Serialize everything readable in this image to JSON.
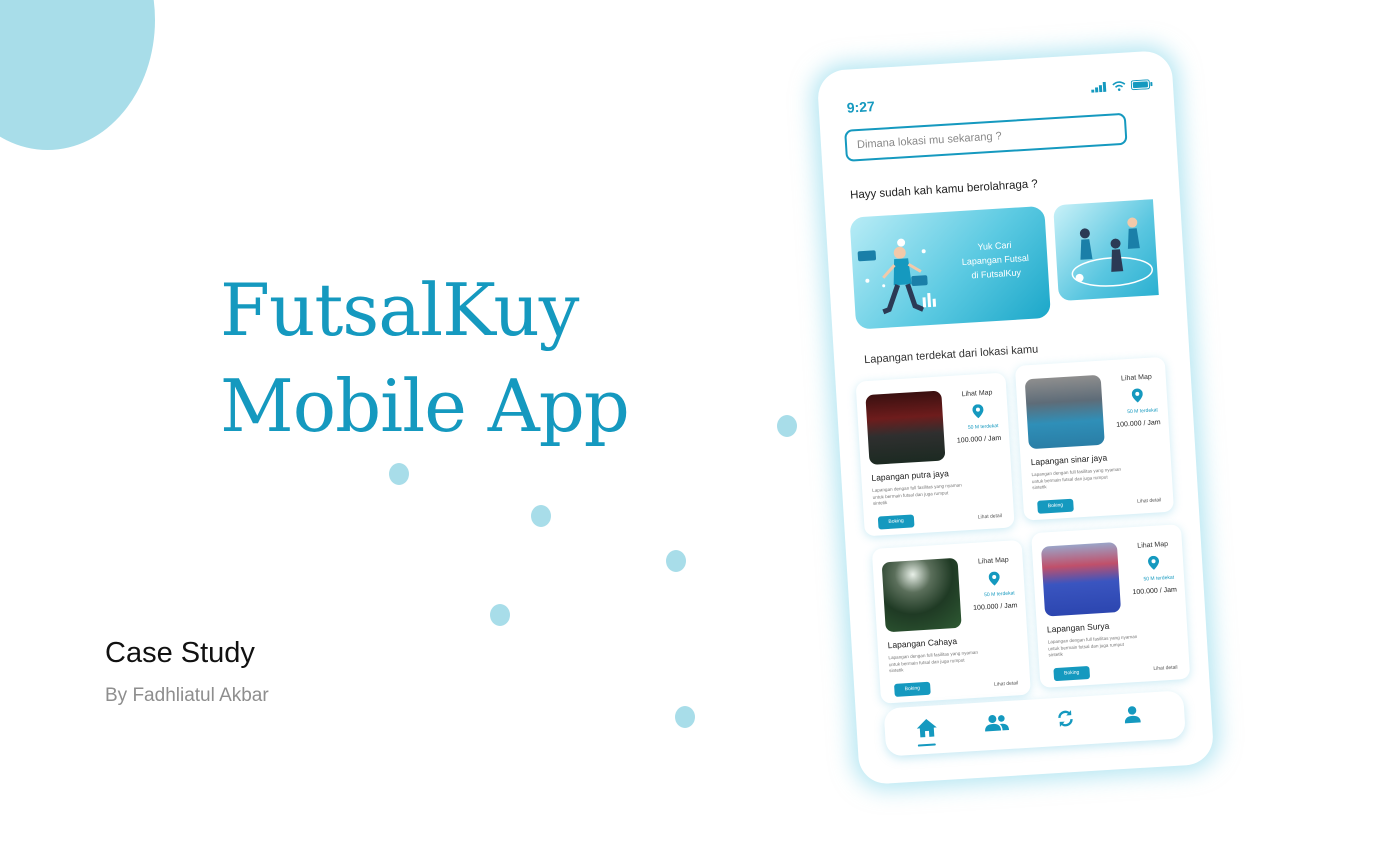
{
  "hero": {
    "title_line1": "FutsalKuy",
    "title_line2": "Mobile App",
    "subtitle": "Case Study",
    "byline": "By Fadhliatul Akbar"
  },
  "colors": {
    "brand": "#1599bf",
    "accent_soft": "#a8dde9"
  },
  "phone": {
    "status_time": "9:27",
    "search_placeholder": "Dimana lokasi mu sekarang ?",
    "greeting": "Hayy sudah kah kamu berolahraga ?",
    "banner": {
      "line1": "Yuk Cari",
      "line2": "Lapangan Futsal",
      "line3": "di FutsalKuy"
    },
    "section_title": "Lapangan terdekat dari lokasi kamu",
    "cards": [
      {
        "name": "Lapangan putra jaya",
        "map_label": "Lihat Map",
        "distance": "50 M terdekat",
        "price": "100.000 / Jam",
        "description": "Lapangan dengan full fasilitas yang nyaman untuk bermain futsal dan juga rumput sintetik",
        "book_label": "Boking",
        "detail_label": "Lihat detail"
      },
      {
        "name": "Lapangan sinar jaya",
        "map_label": "Lihat Map",
        "distance": "50 M terdekat",
        "price": "100.000 / Jam",
        "description": "Lapangan dengan full fasilitas yang nyaman untuk bermain futsal dan juga rumput sintetik",
        "book_label": "Boking",
        "detail_label": "Lihat detail"
      },
      {
        "name": "Lapangan Cahaya",
        "map_label": "Lihat Map",
        "distance": "50 M terdekat",
        "price": "100.000 / Jam",
        "description": "Lapangan dengan full fasilitas yang nyaman untuk bermain futsal dan juga rumput sintetik",
        "book_label": "Boking",
        "detail_label": "Lihat detail"
      },
      {
        "name": "Lapangan Surya",
        "map_label": "Lihat Map",
        "distance": "50 M terdekat",
        "price": "100.000 / Jam",
        "description": "Lapangan dengan full fasilitas yang nyaman untuk bermain futsal dan juga rumput sintetik",
        "book_label": "Boking",
        "detail_label": "Lihat detail"
      }
    ],
    "nav_icons": [
      "home-icon",
      "users-icon",
      "refresh-icon",
      "user-icon"
    ]
  }
}
